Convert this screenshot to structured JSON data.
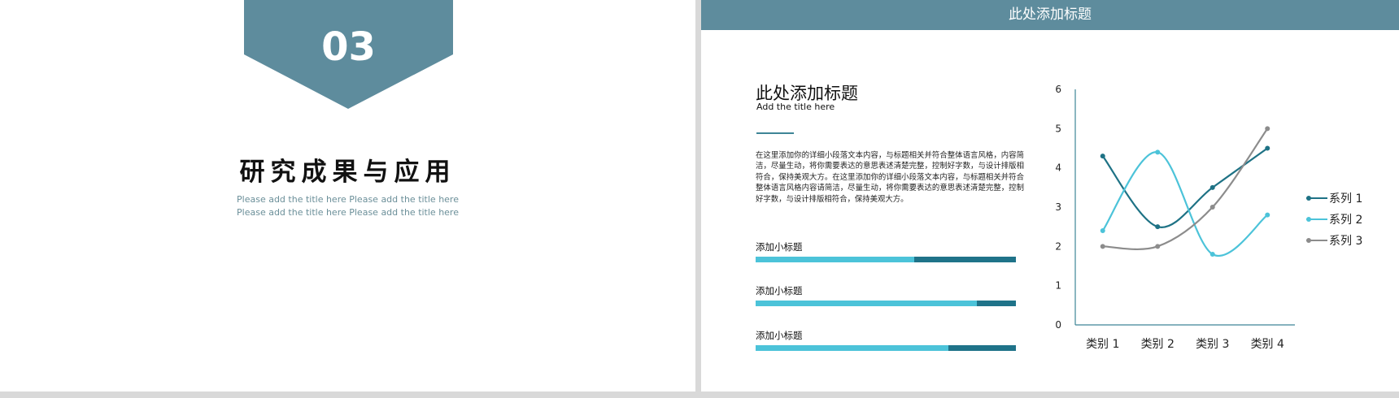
{
  "left_slide": {
    "section_number": "03",
    "title": "研究成果与应用",
    "subtitle": "Please add the title here Please add the title here Please add the title here Please add the title here"
  },
  "right_slide": {
    "header_title": "此处添加标题",
    "heading": "此处添加标题",
    "heading_sub": "Add the title  here",
    "body": "在这里添加你的详细小段落文本内容，与标题相关并符合整体语言风格，内容简洁，尽量生动，将你需要表达的意思表述清楚完整，控制好字数，与设计排版相符合，保持美观大方。在这里添加你的详细小段落文本内容，与标题相关并符合整体语言风格内容请简洁，尽量生动，将你需要表达的意思表述清楚完整，控制好字数，与设计排版相符合，保持美观大方。",
    "progress_items": [
      {
        "label": "添加小标题",
        "value": 0.61
      },
      {
        "label": "添加小标题",
        "value": 0.85
      },
      {
        "label": "添加小标题",
        "value": 0.74
      }
    ]
  },
  "colors": {
    "accent": "#5e8c9d",
    "bar_light": "#4cc3d9",
    "bar_dark": "#1f7389"
  },
  "chart_data": {
    "type": "line",
    "categories": [
      "类别 1",
      "类别 2",
      "类别 3",
      "类别 4"
    ],
    "ylim": [
      0,
      6
    ],
    "yticks": [
      0,
      1,
      2,
      3,
      4,
      5,
      6
    ],
    "smooth": true,
    "legend_position": "right",
    "series": [
      {
        "name": "系列 1",
        "values": [
          4.3,
          2.5,
          3.5,
          4.5
        ],
        "color": "#1e7285"
      },
      {
        "name": "系列 2",
        "values": [
          2.4,
          4.4,
          1.8,
          2.8
        ],
        "color": "#4cc3d9"
      },
      {
        "name": "系列 3",
        "values": [
          2.0,
          2.0,
          3.0,
          5.0
        ],
        "color": "#8c8c8c"
      }
    ]
  }
}
